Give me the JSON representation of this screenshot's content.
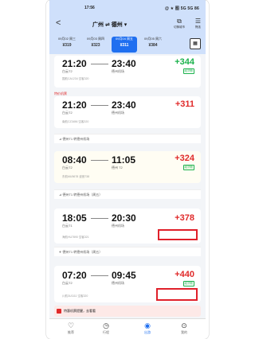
{
  "status": {
    "time": "17:56",
    "right": "@ ★ 图 5G 5G 86"
  },
  "topbar": {
    "back": "<",
    "route": "广州 ⇌ 德州 ▾",
    "icons": [
      {
        "sym": "⧉",
        "label": "切换城市"
      },
      {
        "sym": "☰",
        "label": "筛选"
      }
    ]
  },
  "dates": [
    {
      "d": "09月02 周三",
      "p": "¥319"
    },
    {
      "d": "09月03 周四",
      "p": "¥323"
    },
    {
      "d": "09月04 周五",
      "p": "¥311"
    },
    {
      "d": "09月05 周六",
      "p": "¥384"
    }
  ],
  "calendar_icon": "▦",
  "flights": [
    {
      "dep": "21:20",
      "arr": "23:40",
      "depstn": "白云T2",
      "arrstn": "德州机场",
      "price": "+344",
      "price_color": "green",
      "note": "国航CA1234 空客320",
      "badge": "经济舱"
    },
    {
      "dep": "21:20",
      "arr": "23:40",
      "depstn": "白云T2",
      "arrstn": "德州机场",
      "price": "+311",
      "price_color": "red",
      "note": "南航CZ3456 空客320",
      "badge": "",
      "tag": "特价机票"
    },
    {
      "dep": "08:40",
      "arr": "11:05",
      "depstn": "白云T2",
      "arrstn": "德州 T2",
      "price": "+324",
      "price_color": "red",
      "note": "东航MU5678 波音738",
      "badge": "经济舱"
    },
    {
      "dep": "18:05",
      "arr": "20:30",
      "depstn": "白云T1",
      "arrstn": "德州机场",
      "price": "+378",
      "price_color": "red",
      "note": "海航HU7890 空客321",
      "badge": ""
    },
    {
      "dep": "07:20",
      "arr": "09:45",
      "depstn": "白云T2",
      "arrstn": "德州机场",
      "price": "+440",
      "price_color": "red",
      "note": "川航3U1111 空客320",
      "badge": "经济舱"
    }
  ],
  "strips": [
    "⊿ 德州T1 转德州机场",
    "⊿ 德州T1 转德州机场（周五）",
    "✈ 德州T1 转德州机场（周五）"
  ],
  "footer_alert": "特惠机票提醒，去看看",
  "tabs": [
    {
      "sym": "♡",
      "label": "推荐"
    },
    {
      "sym": "◷",
      "label": "行程"
    },
    {
      "sym": "◉",
      "label": "出游"
    },
    {
      "sym": "⊙",
      "label": "我的"
    }
  ]
}
